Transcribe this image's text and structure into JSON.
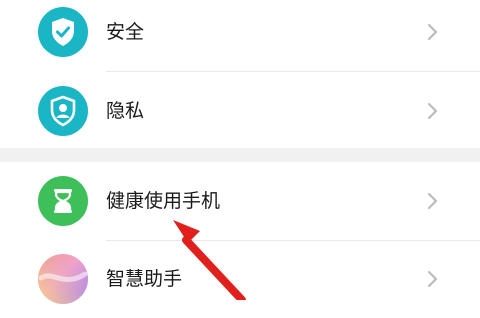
{
  "settings": {
    "items": [
      {
        "label": "安全",
        "icon": "shield-check-icon",
        "icon_color": "#1bb6c6"
      },
      {
        "label": "隐私",
        "icon": "person-shield-icon",
        "icon_color": "#1bb6c6"
      },
      {
        "label": "健康使用手机",
        "icon": "hourglass-icon",
        "icon_color": "#3fbf5a"
      },
      {
        "label": "智慧助手",
        "icon": "gradient-orb-icon",
        "icon_color": "#c58cf0"
      }
    ]
  },
  "annotation": {
    "arrow_color": "#e0201c"
  }
}
